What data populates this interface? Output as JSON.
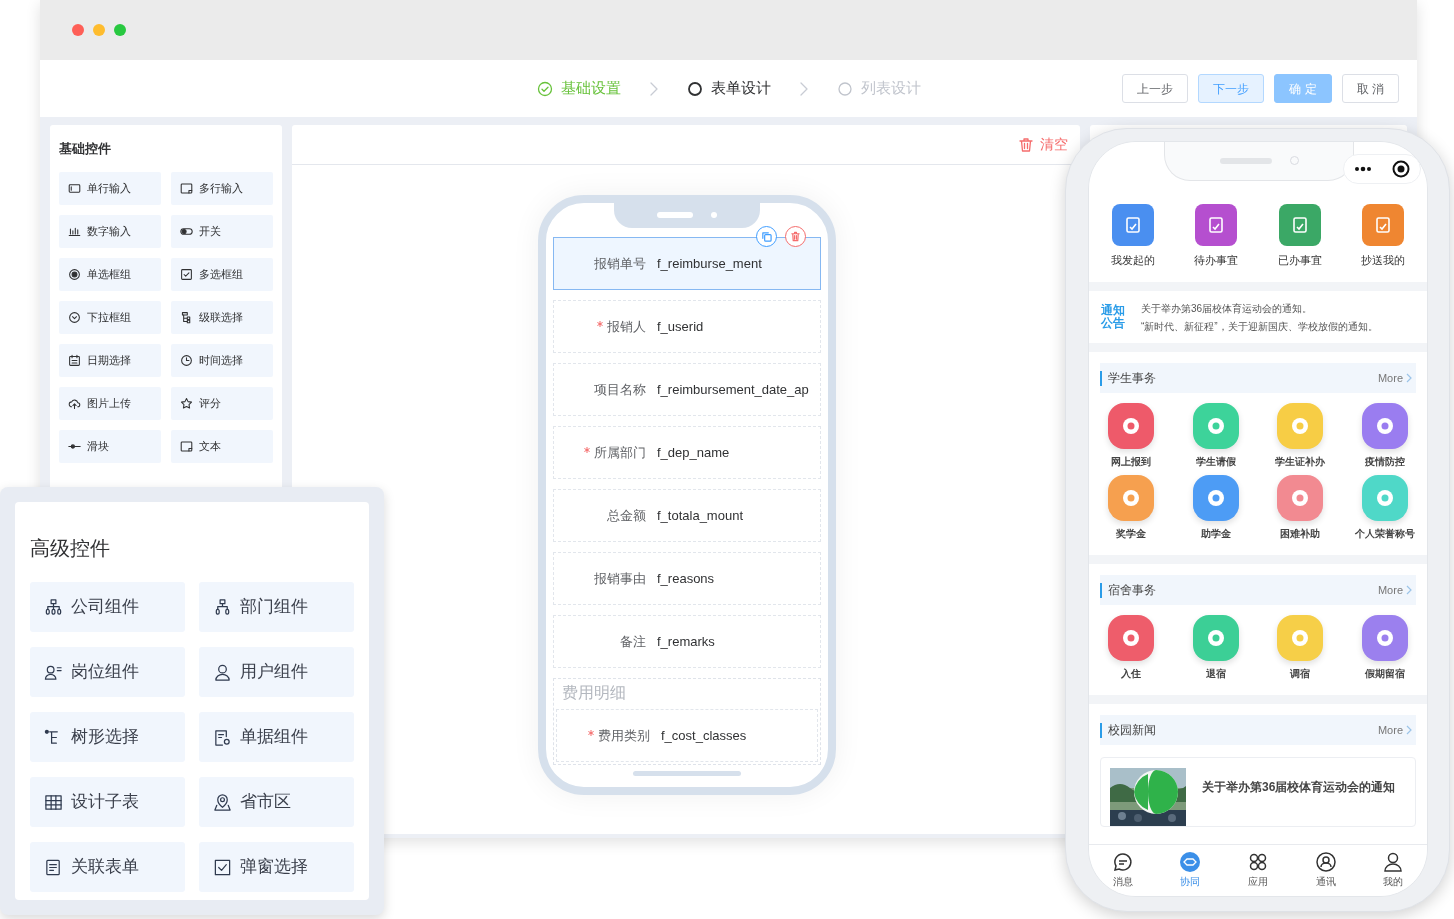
{
  "steps": [
    {
      "label": "基础设置",
      "completed": true,
      "selected": false
    },
    {
      "label": "表单设计",
      "completed": false,
      "selected": true
    },
    {
      "label": "列表设计",
      "completed": false,
      "selected": false
    }
  ],
  "header_buttons": [
    {
      "label": "上一步",
      "kind": "default"
    },
    {
      "label": "下一步",
      "kind": "light"
    },
    {
      "label": "确 定",
      "kind": "primary"
    },
    {
      "label": "取 消",
      "kind": "default"
    }
  ],
  "basic_controls": {
    "title": "基础控件",
    "items": [
      "单行输入",
      "多行输入",
      "数字输入",
      "开关",
      "单选框组",
      "多选框组",
      "下拉框组",
      "级联选择",
      "日期选择",
      "时间选择",
      "图片上传",
      "评分",
      "滑块",
      "文本"
    ]
  },
  "canvas": {
    "clear_button": "清空",
    "fields": [
      {
        "label": "报销单号",
        "value": "f_reimburse_ment",
        "required": false,
        "selected": true
      },
      {
        "label": "报销人",
        "value": "f_userid",
        "required": true,
        "selected": false
      },
      {
        "label": "项目名称",
        "value": "f_reimbursement_date_ap",
        "required": false,
        "selected": false
      },
      {
        "label": "所属部门",
        "value": "f_dep_name",
        "required": true,
        "selected": false
      },
      {
        "label": "总金额",
        "value": "f_totala_mount",
        "required": false,
        "selected": false
      },
      {
        "label": "报销事由",
        "value": "f_reasons",
        "required": false,
        "selected": false
      },
      {
        "label": "备注",
        "value": "f_remarks",
        "required": false,
        "selected": false
      }
    ],
    "subtable": {
      "title": "费用明细",
      "fields": [
        {
          "label": "费用类别",
          "value": "f_cost_classes",
          "required": true,
          "selected": false
        }
      ]
    }
  },
  "mobile_preview": {
    "shortcuts": [
      {
        "label": "我发起的",
        "color": "#4a8ff0"
      },
      {
        "label": "待办事宜",
        "color": "#b54fcf"
      },
      {
        "label": "已办事宜",
        "color": "#3ba866"
      },
      {
        "label": "抄送我的",
        "color": "#ef8631"
      }
    ],
    "notice": {
      "label": "通知公告",
      "lines": [
        "关于举办第36届校体育运动会的通知。",
        "“新时代、新征程”，关于迎新国庆、学校放假的通知。"
      ]
    },
    "sections": [
      {
        "title": "学生事务",
        "more": "More",
        "apps": [
          {
            "label": "网上报到",
            "color": "#ee5a6a"
          },
          {
            "label": "学生请假",
            "color": "#3dd39a"
          },
          {
            "label": "学生证补办",
            "color": "#f7cd45"
          },
          {
            "label": "疫情防控",
            "color": "#9a7df0"
          },
          {
            "label": "奖学金",
            "color": "#f6a04f"
          },
          {
            "label": "助学金",
            "color": "#4d9cf5"
          },
          {
            "label": "困难补助",
            "color": "#f28a91"
          },
          {
            "label": "个人荣誉称号",
            "color": "#4fd8c8"
          }
        ]
      },
      {
        "title": "宿舍事务",
        "more": "More",
        "apps": [
          {
            "label": "入住",
            "color": "#ee5d6b"
          },
          {
            "label": "退宿",
            "color": "#3ccf96"
          },
          {
            "label": "调宿",
            "color": "#f6cf48"
          },
          {
            "label": "假期留宿",
            "color": "#9b80ee"
          }
        ]
      }
    ],
    "news": {
      "title": "校园新闻",
      "more": "More",
      "items": [
        {
          "title": "关于举办第36届校体育运动会的通知"
        }
      ]
    },
    "tabbar": [
      {
        "label": "消息",
        "selected": false
      },
      {
        "label": "协同",
        "selected": true
      },
      {
        "label": "应用",
        "selected": false
      },
      {
        "label": "通讯",
        "selected": false
      },
      {
        "label": "我的",
        "selected": false
      }
    ]
  },
  "advanced_controls": {
    "title": "高级控件",
    "items": [
      "公司组件",
      "部门组件",
      "岗位组件",
      "用户组件",
      "树形选择",
      "单据组件",
      "设计子表",
      "省市区",
      "关联表单",
      "弹窗选择"
    ]
  }
}
